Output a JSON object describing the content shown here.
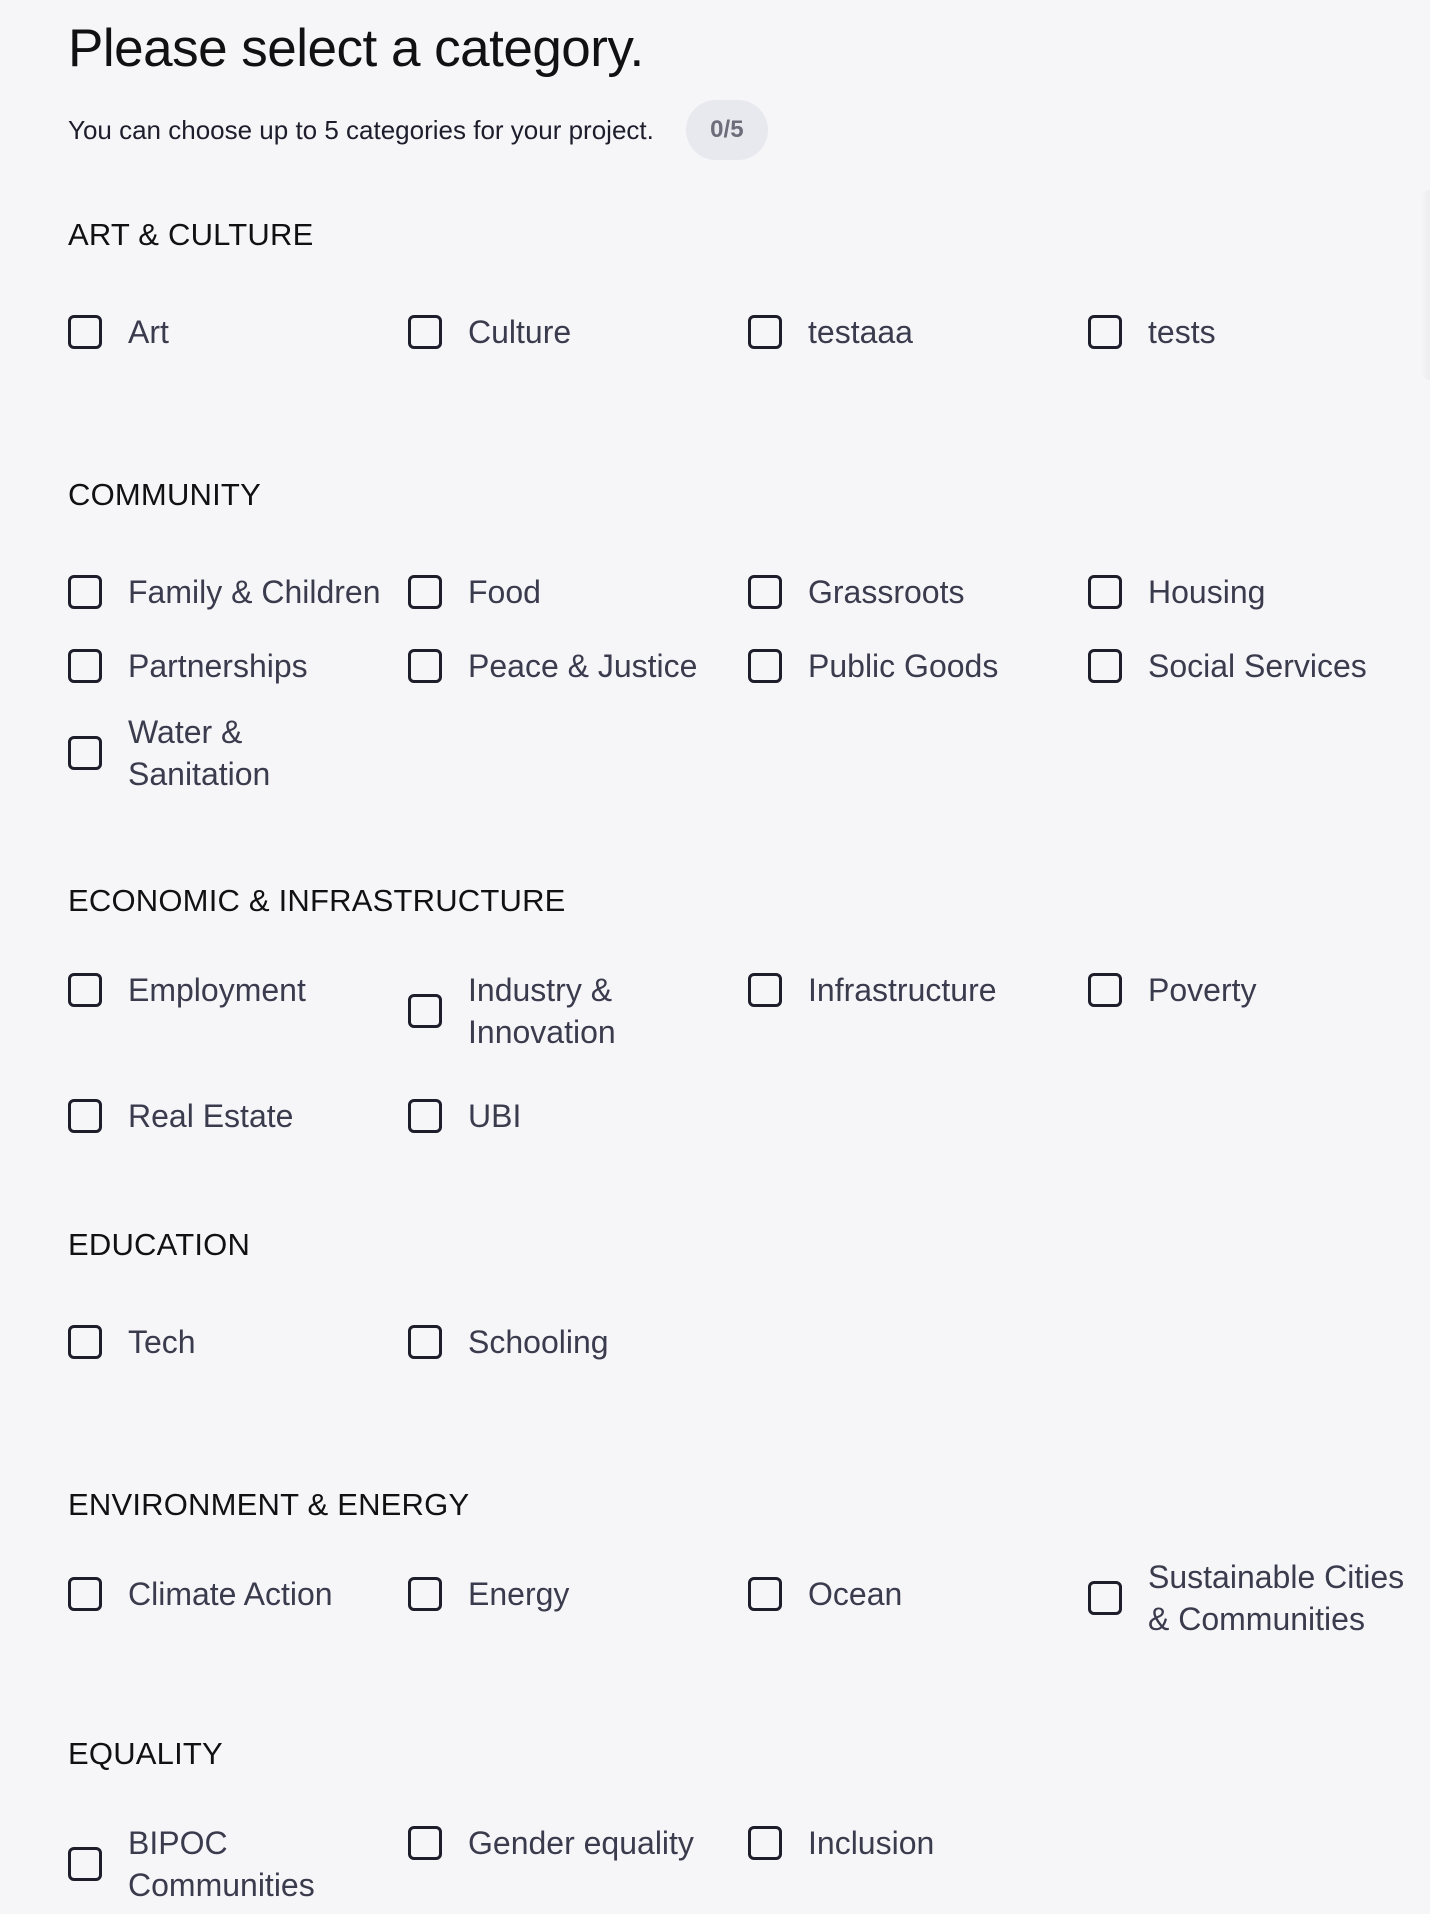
{
  "header": {
    "title": "Please select a category.",
    "subtitle": "You can choose up to 5 categories for your project.",
    "counter": "0/5"
  },
  "sections": {
    "art": {
      "title": "ART & CULTURE",
      "options": [
        "Art",
        "Culture",
        "testaaa",
        "tests"
      ]
    },
    "community": {
      "title": "COMMUNITY",
      "options": [
        "Family & Children",
        "Food",
        "Grassroots",
        "Housing",
        "Partnerships",
        "Peace & Justice",
        "Public Goods",
        "Social Services",
        "Water & Sanitation"
      ]
    },
    "economic": {
      "title": "ECONOMIC & INFRASTRUCTURE",
      "options": [
        "Employment",
        "Industry & Innovation",
        "Infrastructure",
        "Poverty",
        "Real Estate",
        "UBI"
      ]
    },
    "education": {
      "title": "EDUCATION",
      "options": [
        "Tech",
        "Schooling"
      ]
    },
    "environment": {
      "title": "ENVIRONMENT & ENERGY",
      "options": [
        "Climate Action",
        "Energy",
        "Ocean",
        "Sustainable Cities & Communities"
      ]
    },
    "equality": {
      "title": "EQUALITY",
      "options": [
        "BIPOC Communities",
        "Gender equality",
        "Inclusion"
      ]
    }
  }
}
